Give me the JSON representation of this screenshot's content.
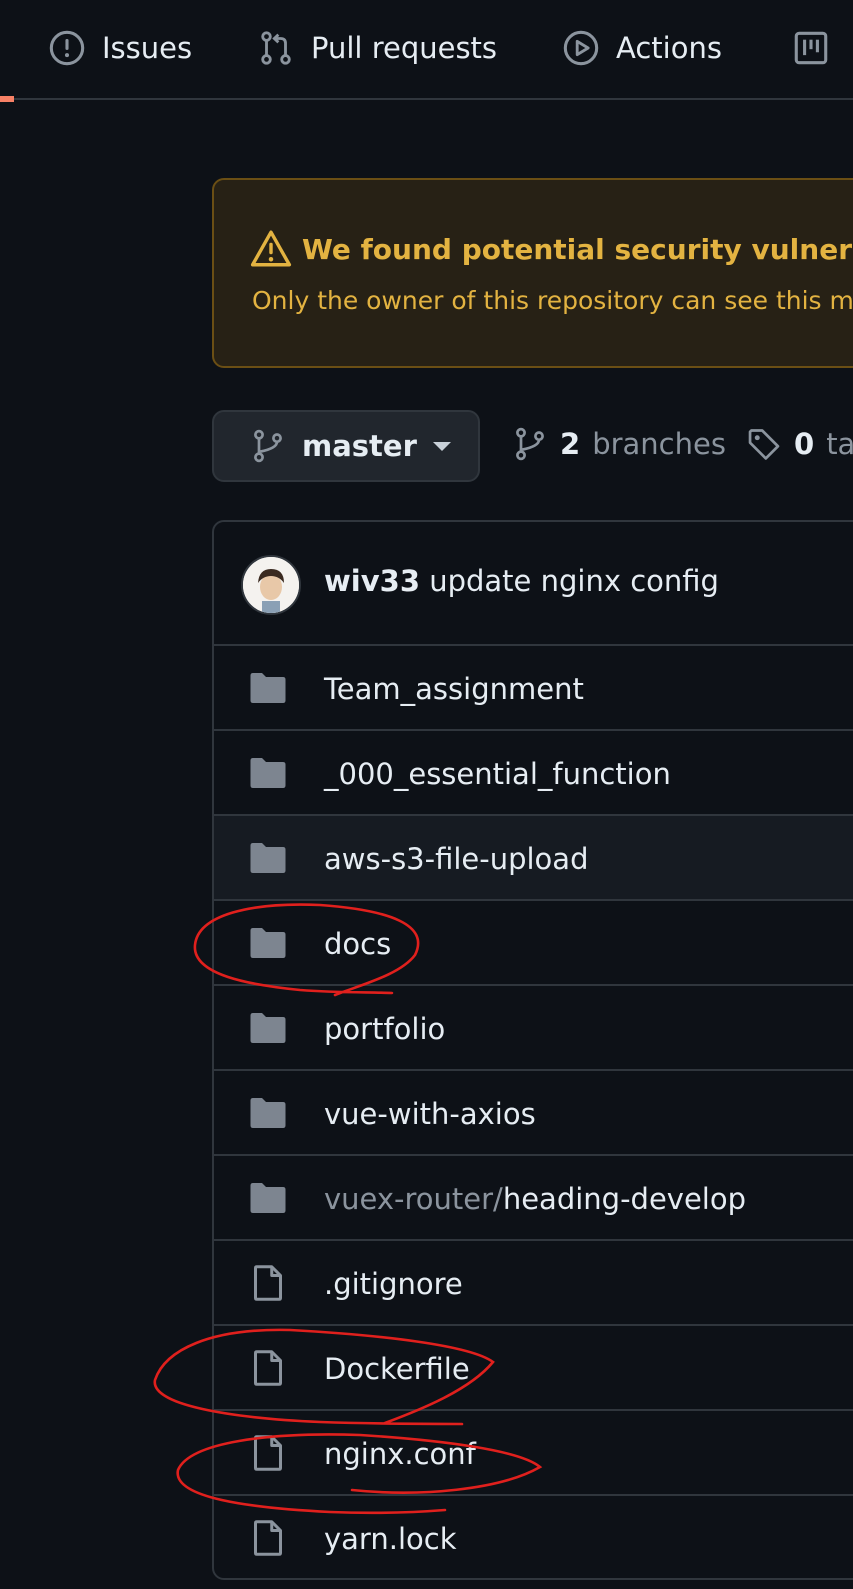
{
  "nav": {
    "tabs": [
      {
        "label": "Issues",
        "icon": "issue-icon"
      },
      {
        "label": "Pull requests",
        "icon": "pull-request-icon"
      },
      {
        "label": "Actions",
        "icon": "play-icon"
      },
      {
        "label": "",
        "icon": "project-icon"
      }
    ]
  },
  "banner": {
    "title": "We found potential security vulnerabilities",
    "text": "Only the owner of this repository can see this message."
  },
  "branch": {
    "current": "master",
    "branches_count": "2",
    "branches_label": "branches",
    "tags_count": "0",
    "tags_label": "tags"
  },
  "commit": {
    "author": "wiv33",
    "message": "update nginx config"
  },
  "files": [
    {
      "type": "folder",
      "name": "Team_assignment"
    },
    {
      "type": "folder",
      "name": "_000_essential_function"
    },
    {
      "type": "folder",
      "name": "aws-s3-file-upload"
    },
    {
      "type": "folder",
      "name": "docs"
    },
    {
      "type": "folder",
      "name": "portfolio"
    },
    {
      "type": "folder",
      "name": "vue-with-axios"
    },
    {
      "type": "folder",
      "prefix": "vuex-router/",
      "name": "heading-develop"
    },
    {
      "type": "file",
      "name": ".gitignore"
    },
    {
      "type": "file",
      "name": "Dockerfile"
    },
    {
      "type": "file",
      "name": "nginx.conf"
    },
    {
      "type": "file",
      "name": "yarn.lock"
    }
  ],
  "colors": {
    "background": "#0d1117",
    "border": "#30363d",
    "warning": "#e3b341",
    "annotation": "#e0201d",
    "active_tab": "#f78166"
  }
}
